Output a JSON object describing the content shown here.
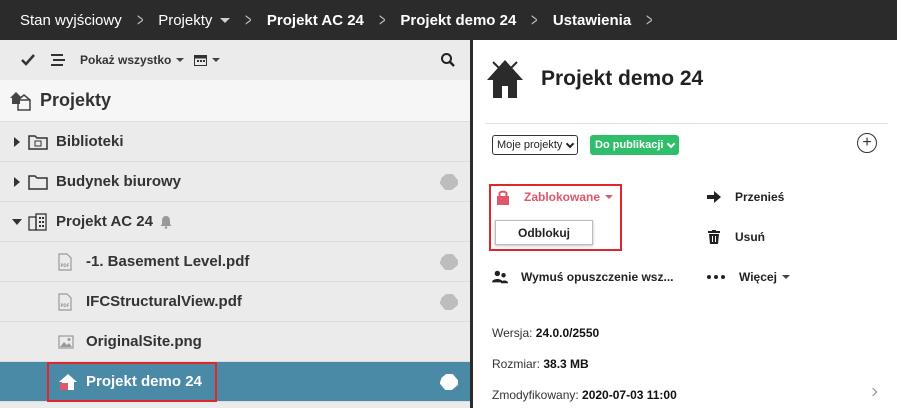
{
  "breadcrumb": {
    "items": [
      "Stan wyjściowy",
      "Projekty",
      "Projekt AC 24",
      "Projekt demo 24",
      "Ustawienia"
    ]
  },
  "toolbar": {
    "show_all_label": "Pokaż wszystko"
  },
  "tree": {
    "header": "Projekty",
    "rows": [
      {
        "label": "Biblioteki",
        "icon": "library-folder-icon"
      },
      {
        "label": "Budynek biurowy",
        "icon": "folder-icon"
      },
      {
        "label": "Projekt AC 24",
        "icon": "building-icon"
      },
      {
        "label": "-1. Basement Level.pdf",
        "icon": "pdf-file-icon"
      },
      {
        "label": "IFCStructuralView.pdf",
        "icon": "pdf-file-icon"
      },
      {
        "label": "OriginalSite.png",
        "icon": "image-file-icon"
      },
      {
        "label": "Projekt demo 24",
        "icon": "project-house-icon"
      }
    ]
  },
  "detail": {
    "title": "Projekt demo 24",
    "project_filter": "Moje projekty",
    "status": "Do publikacji",
    "actions": {
      "locked": "Zablokowane",
      "unlock": "Odblokuj",
      "move": "Przenieś",
      "delete": "Usuń",
      "force_exit": "Wymuś opuszczenie wsz...",
      "more": "Więcej"
    },
    "meta": {
      "version_label": "Wersja:",
      "version_value": "24.0.0/2550",
      "size_label": "Rozmiar:",
      "size_value": "38.3 MB",
      "modified_label": "Zmodyfikowany:",
      "modified_value": "2020-07-03 11:00"
    }
  },
  "colors": {
    "topbar": "#2b2b2b",
    "selected_row": "#4a8aa7",
    "status_green": "#2fbf6b",
    "locked_red": "#e0566a",
    "highlight_red": "#e0262c"
  }
}
